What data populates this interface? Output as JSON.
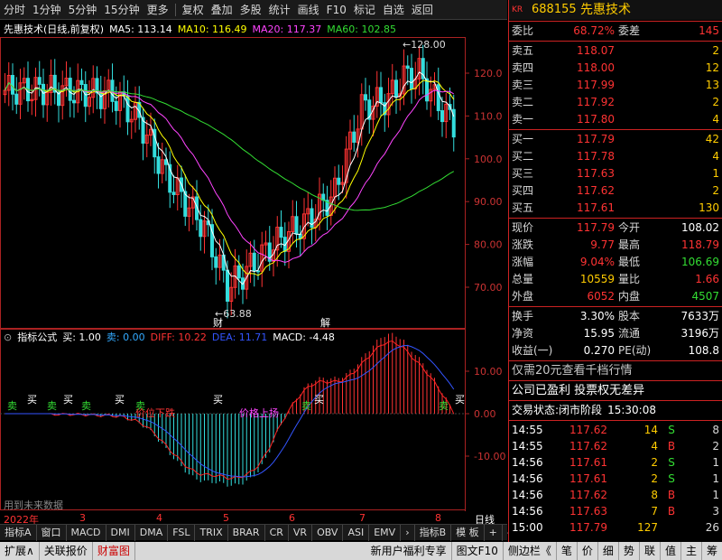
{
  "toolbar": {
    "items": [
      "分时",
      "1分钟",
      "5分钟",
      "15分钟",
      "更多",
      "复权",
      "叠加",
      "多股",
      "统计",
      "画线",
      "F10",
      "标记",
      "自选",
      "返回"
    ]
  },
  "header": {
    "stock_name": "先惠技术(日线,前复权)",
    "ma5": "MA5: 113.14",
    "ma10": "MA10: 116.49",
    "ma20": "MA20: 117.37",
    "ma60": "MA60: 102.85",
    "color_ma5": "#ffffff",
    "color_ma10": "#ffff00",
    "color_ma20": "#ff44ff",
    "color_ma60": "#33dd33"
  },
  "main_chart": {
    "y_ticks": [
      "120.0",
      "110.0",
      "100.0",
      "90.00",
      "80.00",
      "70.00"
    ],
    "y_values": [
      120,
      110,
      100,
      90,
      80,
      70
    ],
    "high_label": "128.00",
    "low_label": "63.88",
    "marker1": "财",
    "marker2": "解"
  },
  "indicator": {
    "title": "指标公式",
    "buy": "买: 1.00",
    "sell": "卖: 0.00",
    "diff": "DIFF: 10.22",
    "dea": "DEA: 11.71",
    "macd": "MACD: -4.48",
    "y_ticks": [
      "10.00",
      "0.00",
      "-10.00"
    ],
    "signals": [
      "卖",
      "买",
      "卖",
      "买",
      "卖",
      "买",
      "卖",
      "买",
      "卖",
      "买",
      "卖",
      "买"
    ],
    "note": "用到未来数据",
    "label_a": "价位下跌",
    "label_b": "价格上扬"
  },
  "x_axis": {
    "labels": [
      "2022年",
      "3",
      "4",
      "5",
      "6",
      "7",
      "8"
    ],
    "right": "日线"
  },
  "bottom_tabs": [
    "指标A",
    "窗口",
    "MACD",
    "DMI",
    "DMA",
    "FSL",
    "TRIX",
    "BRAR",
    "CR",
    "VR",
    "OBV",
    "ASI",
    "EMV",
    "指标B",
    "模 板",
    "+",
    "-"
  ],
  "status_bar": {
    "left": [
      "扩展∧",
      "关联报价",
      "财富图"
    ],
    "right": [
      "新用户福利专享",
      "图文F10",
      "侧边栏《"
    ],
    "icons": [
      "笔",
      "价",
      "细",
      "势",
      "联",
      "值",
      "主",
      "筹"
    ]
  },
  "quote": {
    "market": "KR",
    "code": "688155",
    "name": "先惠技术",
    "weibi_label": "委比",
    "weibi": "68.72%",
    "weicha_label": "委差",
    "weicha": "145",
    "asks": [
      {
        "label": "卖五",
        "price": "118.07",
        "vol": "2"
      },
      {
        "label": "卖四",
        "price": "118.00",
        "vol": "12"
      },
      {
        "label": "卖三",
        "price": "117.99",
        "vol": "13"
      },
      {
        "label": "卖二",
        "price": "117.92",
        "vol": "2"
      },
      {
        "label": "卖一",
        "price": "117.80",
        "vol": "4"
      }
    ],
    "bids": [
      {
        "label": "买一",
        "price": "117.79",
        "vol": "42"
      },
      {
        "label": "买二",
        "price": "117.78",
        "vol": "4"
      },
      {
        "label": "买三",
        "price": "117.63",
        "vol": "1"
      },
      {
        "label": "买四",
        "price": "117.62",
        "vol": "2"
      },
      {
        "label": "买五",
        "price": "117.61",
        "vol": "130"
      }
    ],
    "stats": [
      {
        "l1": "现价",
        "v1": "117.79",
        "l2": "今开",
        "v2": "108.02"
      },
      {
        "l1": "涨跌",
        "v1": "9.77",
        "l2": "最高",
        "v2": "118.79"
      },
      {
        "l1": "涨幅",
        "v1": "9.04%",
        "l2": "最低",
        "v2": "106.69"
      },
      {
        "l1": "总量",
        "v1": "10559",
        "l2": "量比",
        "v2": "1.66"
      },
      {
        "l1": "外盘",
        "v1": "6052",
        "l2": "内盘",
        "v2": "4507"
      }
    ],
    "stats2": [
      {
        "l1": "换手",
        "v1": "3.30%",
        "l2": "股本",
        "v2": "7633万"
      },
      {
        "l1": "净资",
        "v1": "15.95",
        "l2": "流通",
        "v2": "3196万"
      },
      {
        "l1": "收益(一)",
        "v1": "0.270",
        "l2": "PE(动)",
        "v2": "108.8"
      }
    ],
    "promo1": "仅需20元查看千档行情",
    "promo2": "公司已盈利 投票权无差异",
    "trade_state_label": "交易状态:",
    "trade_state": "闭市阶段",
    "trade_time": "15:30:08",
    "ticks": [
      {
        "t": "14:55",
        "p": "117.62",
        "v": "14",
        "d": "S",
        "n": "8"
      },
      {
        "t": "14:55",
        "p": "117.62",
        "v": "4",
        "d": "B",
        "n": "2"
      },
      {
        "t": "14:56",
        "p": "117.61",
        "v": "2",
        "d": "S",
        "n": "1"
      },
      {
        "t": "14:56",
        "p": "117.61",
        "v": "2",
        "d": "S",
        "n": "1"
      },
      {
        "t": "14:56",
        "p": "117.62",
        "v": "8",
        "d": "B",
        "n": "1"
      },
      {
        "t": "14:56",
        "p": "117.63",
        "v": "7",
        "d": "B",
        "n": "3"
      },
      {
        "t": "15:00",
        "p": "117.79",
        "v": "127",
        "d": "",
        "n": "26"
      }
    ]
  }
}
